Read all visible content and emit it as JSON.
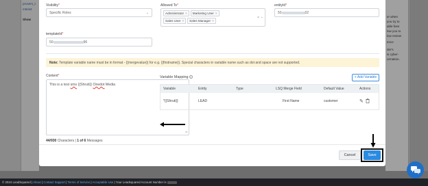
{
  "background": {
    "left_items": [
      "prusers_t",
      "mtest4",
      "Show"
    ],
    "right_items": [
      "er when",
      "you try to",
      "able fees",
      "low you to",
      "low review",
      "",
      "ence",
      "",
      "",
      "der's",
      "is cyber-",
      "ormation."
    ]
  },
  "form": {
    "visibility": {
      "label": "Visibility",
      "value": "Specific Roles"
    },
    "allowed_to": {
      "label": "Allowed To",
      "tags": [
        "Administrator",
        "Marketing User",
        "Sales User",
        "Sales Manager"
      ]
    },
    "entityid": {
      "label": "entityId",
      "value_prefix": "50",
      "value_suffix": "02"
    },
    "templateid": {
      "label": "templateId",
      "value_prefix": "50",
      "value_suffix": "96"
    }
  },
  "note": {
    "bold": "Note:",
    "text": "Template variable name must be in format - {{mergevalue}} for e.g. {{firstname}}. Special characters in variable name such as dot and space are not supported."
  },
  "content": {
    "label": "Content",
    "text_a": "This is a test ",
    "text_sms": "sms",
    "text_b": " {{Shruti}} ",
    "text_onedot": "Onedot",
    "text_c": " Media",
    "chars_used": "44/930",
    "chars_label": "Characters",
    "messages_prefix": "|",
    "messages_value": "1 of 6",
    "messages_label": "Messages"
  },
  "variable_mapping": {
    "title": "Variable Mapping",
    "add_button": "+ Add Variable",
    "columns": [
      "Variable",
      "Entity",
      "Type",
      "LSQ Merge Field",
      "Default Value",
      "Actions"
    ],
    "rows": [
      {
        "variable": "*{{Shruti}}",
        "entity": "LEAD",
        "type": "",
        "lsq_field": "First Name",
        "default": "customer"
      }
    ]
  },
  "footer_buttons": {
    "cancel": "Cancel",
    "save": "Save"
  },
  "page_footer": {
    "copyright": "© 2024 LeadSquared",
    "about": "About",
    "contact": "Contact Support",
    "terms": "Terms of Service",
    "aup": "Acceptable Use",
    "account_prefix": "| Your Leadsquared Account Number is"
  },
  "colors": {
    "primary": "#2a8be0",
    "note_bg": "#fdf3d6",
    "required": "#e53935",
    "footer_bg": "#1f2126"
  },
  "icons": [
    "chevron-down-icon",
    "close-icon",
    "info-icon",
    "pencil-icon",
    "trash-icon",
    "chat-icon",
    "arrow-left-icon",
    "arrow-down-icon"
  ]
}
